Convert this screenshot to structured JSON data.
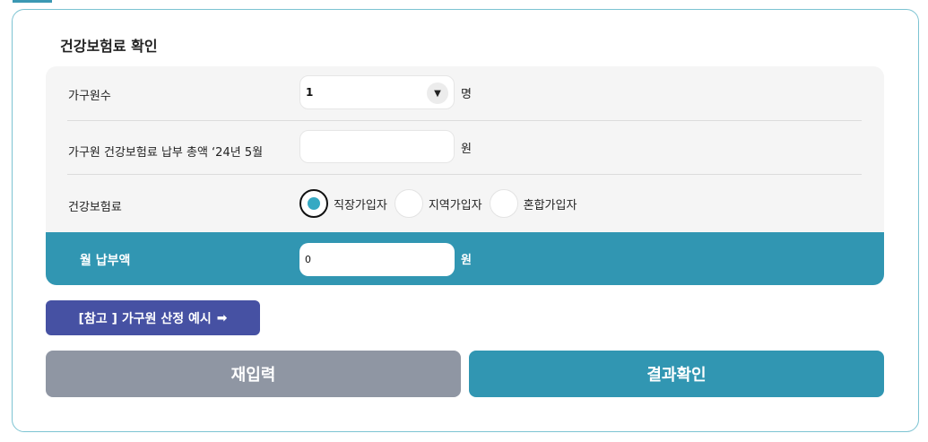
{
  "title": "건강보험료 확인",
  "household": {
    "label": "가구원수",
    "selected": "1",
    "unit": "명"
  },
  "total_premium": {
    "label": "가구원 건강보험료 납부 총액 ‘24년 5월",
    "value": "",
    "unit": "원"
  },
  "insurance_type": {
    "label": "건강보험료",
    "options": [
      "직장가입자",
      "지역가입자",
      "혼합가입자"
    ],
    "selected": "직장가입자"
  },
  "monthly_payment": {
    "label": "월 납부액",
    "value": "0",
    "unit": "원"
  },
  "reference_button": {
    "label": "[참고 ] 가구원 산정 예시",
    "arrow": "➡"
  },
  "reset_button": {
    "label": "재입력"
  },
  "result_button": {
    "label": "결과확인"
  },
  "colors": {
    "accent": "#3196b2",
    "reference": "#4651a3",
    "reset": "#8f96a3",
    "radio_dot": "#36a9c3"
  }
}
